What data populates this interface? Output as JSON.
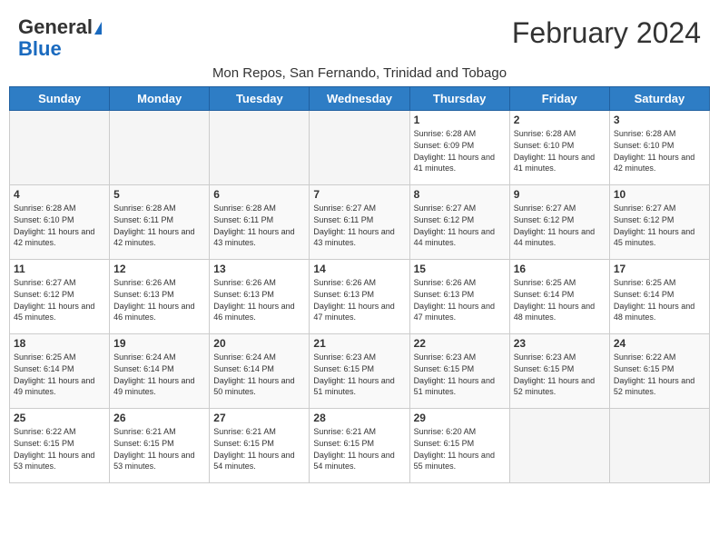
{
  "logo": {
    "general": "General",
    "blue": "Blue"
  },
  "title": "February 2024",
  "subtitle": "Mon Repos, San Fernando, Trinidad and Tobago",
  "headers": [
    "Sunday",
    "Monday",
    "Tuesday",
    "Wednesday",
    "Thursday",
    "Friday",
    "Saturday"
  ],
  "weeks": [
    [
      {
        "day": "",
        "info": "",
        "empty": true
      },
      {
        "day": "",
        "info": "",
        "empty": true
      },
      {
        "day": "",
        "info": "",
        "empty": true
      },
      {
        "day": "",
        "info": "",
        "empty": true
      },
      {
        "day": "1",
        "info": "Sunrise: 6:28 AM\nSunset: 6:09 PM\nDaylight: 11 hours and 41 minutes.",
        "empty": false
      },
      {
        "day": "2",
        "info": "Sunrise: 6:28 AM\nSunset: 6:10 PM\nDaylight: 11 hours and 41 minutes.",
        "empty": false
      },
      {
        "day": "3",
        "info": "Sunrise: 6:28 AM\nSunset: 6:10 PM\nDaylight: 11 hours and 42 minutes.",
        "empty": false
      }
    ],
    [
      {
        "day": "4",
        "info": "Sunrise: 6:28 AM\nSunset: 6:10 PM\nDaylight: 11 hours and 42 minutes.",
        "empty": false
      },
      {
        "day": "5",
        "info": "Sunrise: 6:28 AM\nSunset: 6:11 PM\nDaylight: 11 hours and 42 minutes.",
        "empty": false
      },
      {
        "day": "6",
        "info": "Sunrise: 6:28 AM\nSunset: 6:11 PM\nDaylight: 11 hours and 43 minutes.",
        "empty": false
      },
      {
        "day": "7",
        "info": "Sunrise: 6:27 AM\nSunset: 6:11 PM\nDaylight: 11 hours and 43 minutes.",
        "empty": false
      },
      {
        "day": "8",
        "info": "Sunrise: 6:27 AM\nSunset: 6:12 PM\nDaylight: 11 hours and 44 minutes.",
        "empty": false
      },
      {
        "day": "9",
        "info": "Sunrise: 6:27 AM\nSunset: 6:12 PM\nDaylight: 11 hours and 44 minutes.",
        "empty": false
      },
      {
        "day": "10",
        "info": "Sunrise: 6:27 AM\nSunset: 6:12 PM\nDaylight: 11 hours and 45 minutes.",
        "empty": false
      }
    ],
    [
      {
        "day": "11",
        "info": "Sunrise: 6:27 AM\nSunset: 6:12 PM\nDaylight: 11 hours and 45 minutes.",
        "empty": false
      },
      {
        "day": "12",
        "info": "Sunrise: 6:26 AM\nSunset: 6:13 PM\nDaylight: 11 hours and 46 minutes.",
        "empty": false
      },
      {
        "day": "13",
        "info": "Sunrise: 6:26 AM\nSunset: 6:13 PM\nDaylight: 11 hours and 46 minutes.",
        "empty": false
      },
      {
        "day": "14",
        "info": "Sunrise: 6:26 AM\nSunset: 6:13 PM\nDaylight: 11 hours and 47 minutes.",
        "empty": false
      },
      {
        "day": "15",
        "info": "Sunrise: 6:26 AM\nSunset: 6:13 PM\nDaylight: 11 hours and 47 minutes.",
        "empty": false
      },
      {
        "day": "16",
        "info": "Sunrise: 6:25 AM\nSunset: 6:14 PM\nDaylight: 11 hours and 48 minutes.",
        "empty": false
      },
      {
        "day": "17",
        "info": "Sunrise: 6:25 AM\nSunset: 6:14 PM\nDaylight: 11 hours and 48 minutes.",
        "empty": false
      }
    ],
    [
      {
        "day": "18",
        "info": "Sunrise: 6:25 AM\nSunset: 6:14 PM\nDaylight: 11 hours and 49 minutes.",
        "empty": false
      },
      {
        "day": "19",
        "info": "Sunrise: 6:24 AM\nSunset: 6:14 PM\nDaylight: 11 hours and 49 minutes.",
        "empty": false
      },
      {
        "day": "20",
        "info": "Sunrise: 6:24 AM\nSunset: 6:14 PM\nDaylight: 11 hours and 50 minutes.",
        "empty": false
      },
      {
        "day": "21",
        "info": "Sunrise: 6:23 AM\nSunset: 6:15 PM\nDaylight: 11 hours and 51 minutes.",
        "empty": false
      },
      {
        "day": "22",
        "info": "Sunrise: 6:23 AM\nSunset: 6:15 PM\nDaylight: 11 hours and 51 minutes.",
        "empty": false
      },
      {
        "day": "23",
        "info": "Sunrise: 6:23 AM\nSunset: 6:15 PM\nDaylight: 11 hours and 52 minutes.",
        "empty": false
      },
      {
        "day": "24",
        "info": "Sunrise: 6:22 AM\nSunset: 6:15 PM\nDaylight: 11 hours and 52 minutes.",
        "empty": false
      }
    ],
    [
      {
        "day": "25",
        "info": "Sunrise: 6:22 AM\nSunset: 6:15 PM\nDaylight: 11 hours and 53 minutes.",
        "empty": false
      },
      {
        "day": "26",
        "info": "Sunrise: 6:21 AM\nSunset: 6:15 PM\nDaylight: 11 hours and 53 minutes.",
        "empty": false
      },
      {
        "day": "27",
        "info": "Sunrise: 6:21 AM\nSunset: 6:15 PM\nDaylight: 11 hours and 54 minutes.",
        "empty": false
      },
      {
        "day": "28",
        "info": "Sunrise: 6:21 AM\nSunset: 6:15 PM\nDaylight: 11 hours and 54 minutes.",
        "empty": false
      },
      {
        "day": "29",
        "info": "Sunrise: 6:20 AM\nSunset: 6:15 PM\nDaylight: 11 hours and 55 minutes.",
        "empty": false
      },
      {
        "day": "",
        "info": "",
        "empty": true
      },
      {
        "day": "",
        "info": "",
        "empty": true
      }
    ]
  ]
}
